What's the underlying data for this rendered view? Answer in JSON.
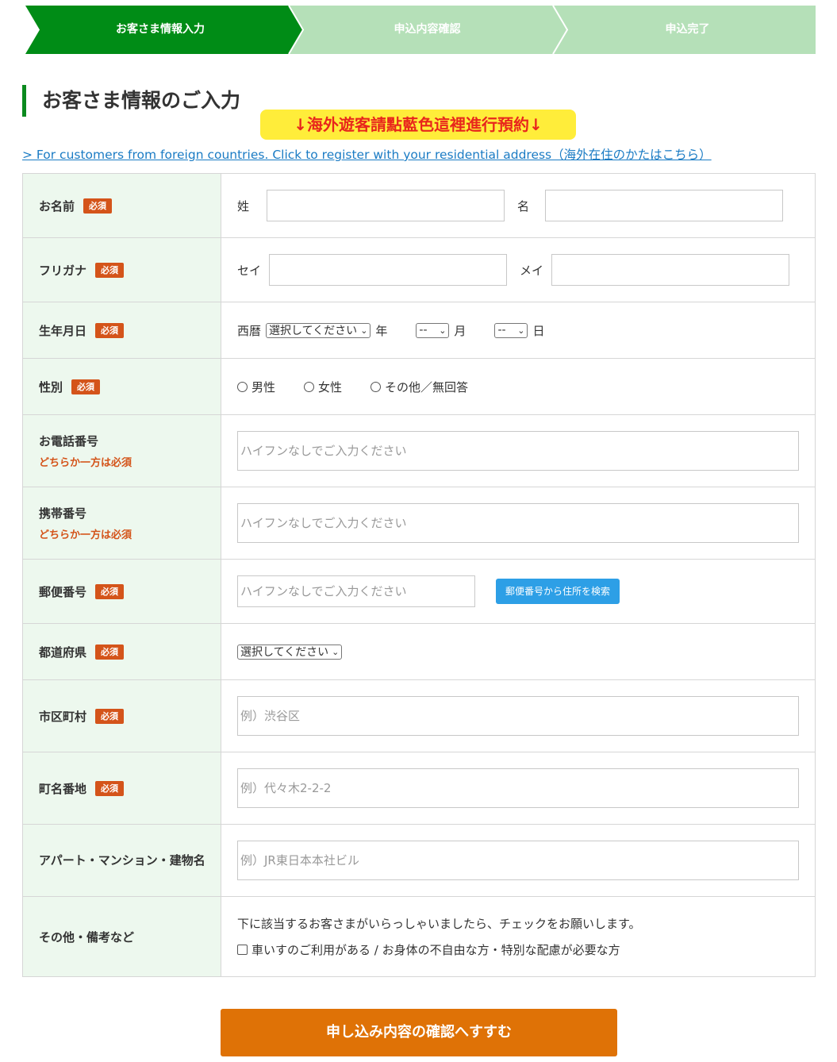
{
  "stepper": {
    "steps": [
      {
        "label": "お客さま情報入力",
        "active": true
      },
      {
        "label": "申込内容確認",
        "active": false
      },
      {
        "label": "申込完了",
        "active": false
      }
    ],
    "active_color": "#008c16",
    "inactive_color": "#b5e0b8"
  },
  "heading": "お客さま情報のご入力",
  "yellow_note": "↓海外遊客請點藍色這裡進行預約↓",
  "foreign_link": "> For customers from foreign countries. Click to register with your residential address（海外在住のかたはこちら）",
  "required_badge": "必須",
  "either_required": "どちらか一方は必須",
  "fields": {
    "name": {
      "label": "お名前",
      "last_label": "姓",
      "first_label": "名"
    },
    "kana": {
      "label": "フリガナ",
      "last_label": "セイ",
      "first_label": "メイ"
    },
    "birth": {
      "label": "生年月日",
      "era_label": "西暦",
      "year_select": "選択してください",
      "year_unit": "年",
      "month_select": "--",
      "month_unit": "月",
      "day_select": "--",
      "day_unit": "日"
    },
    "gender": {
      "label": "性別",
      "options": [
        "男性",
        "女性",
        "その他／無回答"
      ]
    },
    "phone": {
      "label": "お電話番号",
      "placeholder": "ハイフンなしでご入力ください"
    },
    "mobile": {
      "label": "携帯番号",
      "placeholder": "ハイフンなしでご入力ください"
    },
    "zip": {
      "label": "郵便番号",
      "placeholder": "ハイフンなしでご入力ください",
      "button": "郵便番号から住所を検索"
    },
    "prefecture": {
      "label": "都道府県",
      "select": "選択してください"
    },
    "city": {
      "label": "市区町村",
      "placeholder": "例）渋谷区"
    },
    "street": {
      "label": "町名番地",
      "placeholder": "例）代々木2-2-2"
    },
    "building": {
      "label": "アパート・マンション・建物名",
      "placeholder": "例）JR東日本本社ビル"
    },
    "other": {
      "label": "その他・備考など",
      "note": "下に該当するお客さまがいらっしゃいましたら、チェックをお願いします。",
      "checkbox_label": "車いすのご利用がある / お身体の不自由な方・特別な配慮が必要な方"
    }
  },
  "submit": "申し込み内容の確認へすすむ"
}
